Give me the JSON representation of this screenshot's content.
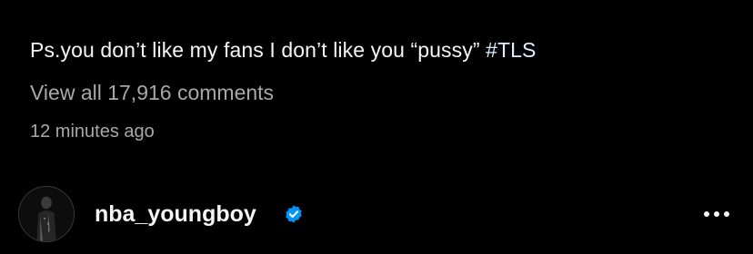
{
  "post": {
    "caption_text": "Ps.you don’t like my fans I don’t like you “pussy”",
    "caption_hashtag": "#TLS",
    "view_comments_label": "View all 17,916 comments",
    "timestamp": "12 minutes ago"
  },
  "author": {
    "username": "nba_youngboy",
    "verified": true,
    "avatar_icon": "avatar-photo",
    "verified_icon": "verified-badge-icon",
    "more_icon": "more-options-icon"
  },
  "colors": {
    "background": "#000000",
    "primary_text": "#f5f5f5",
    "secondary_text": "#a8a8a8",
    "hashtag": "#e0f1ff",
    "verified_blue": "#0095f6"
  }
}
